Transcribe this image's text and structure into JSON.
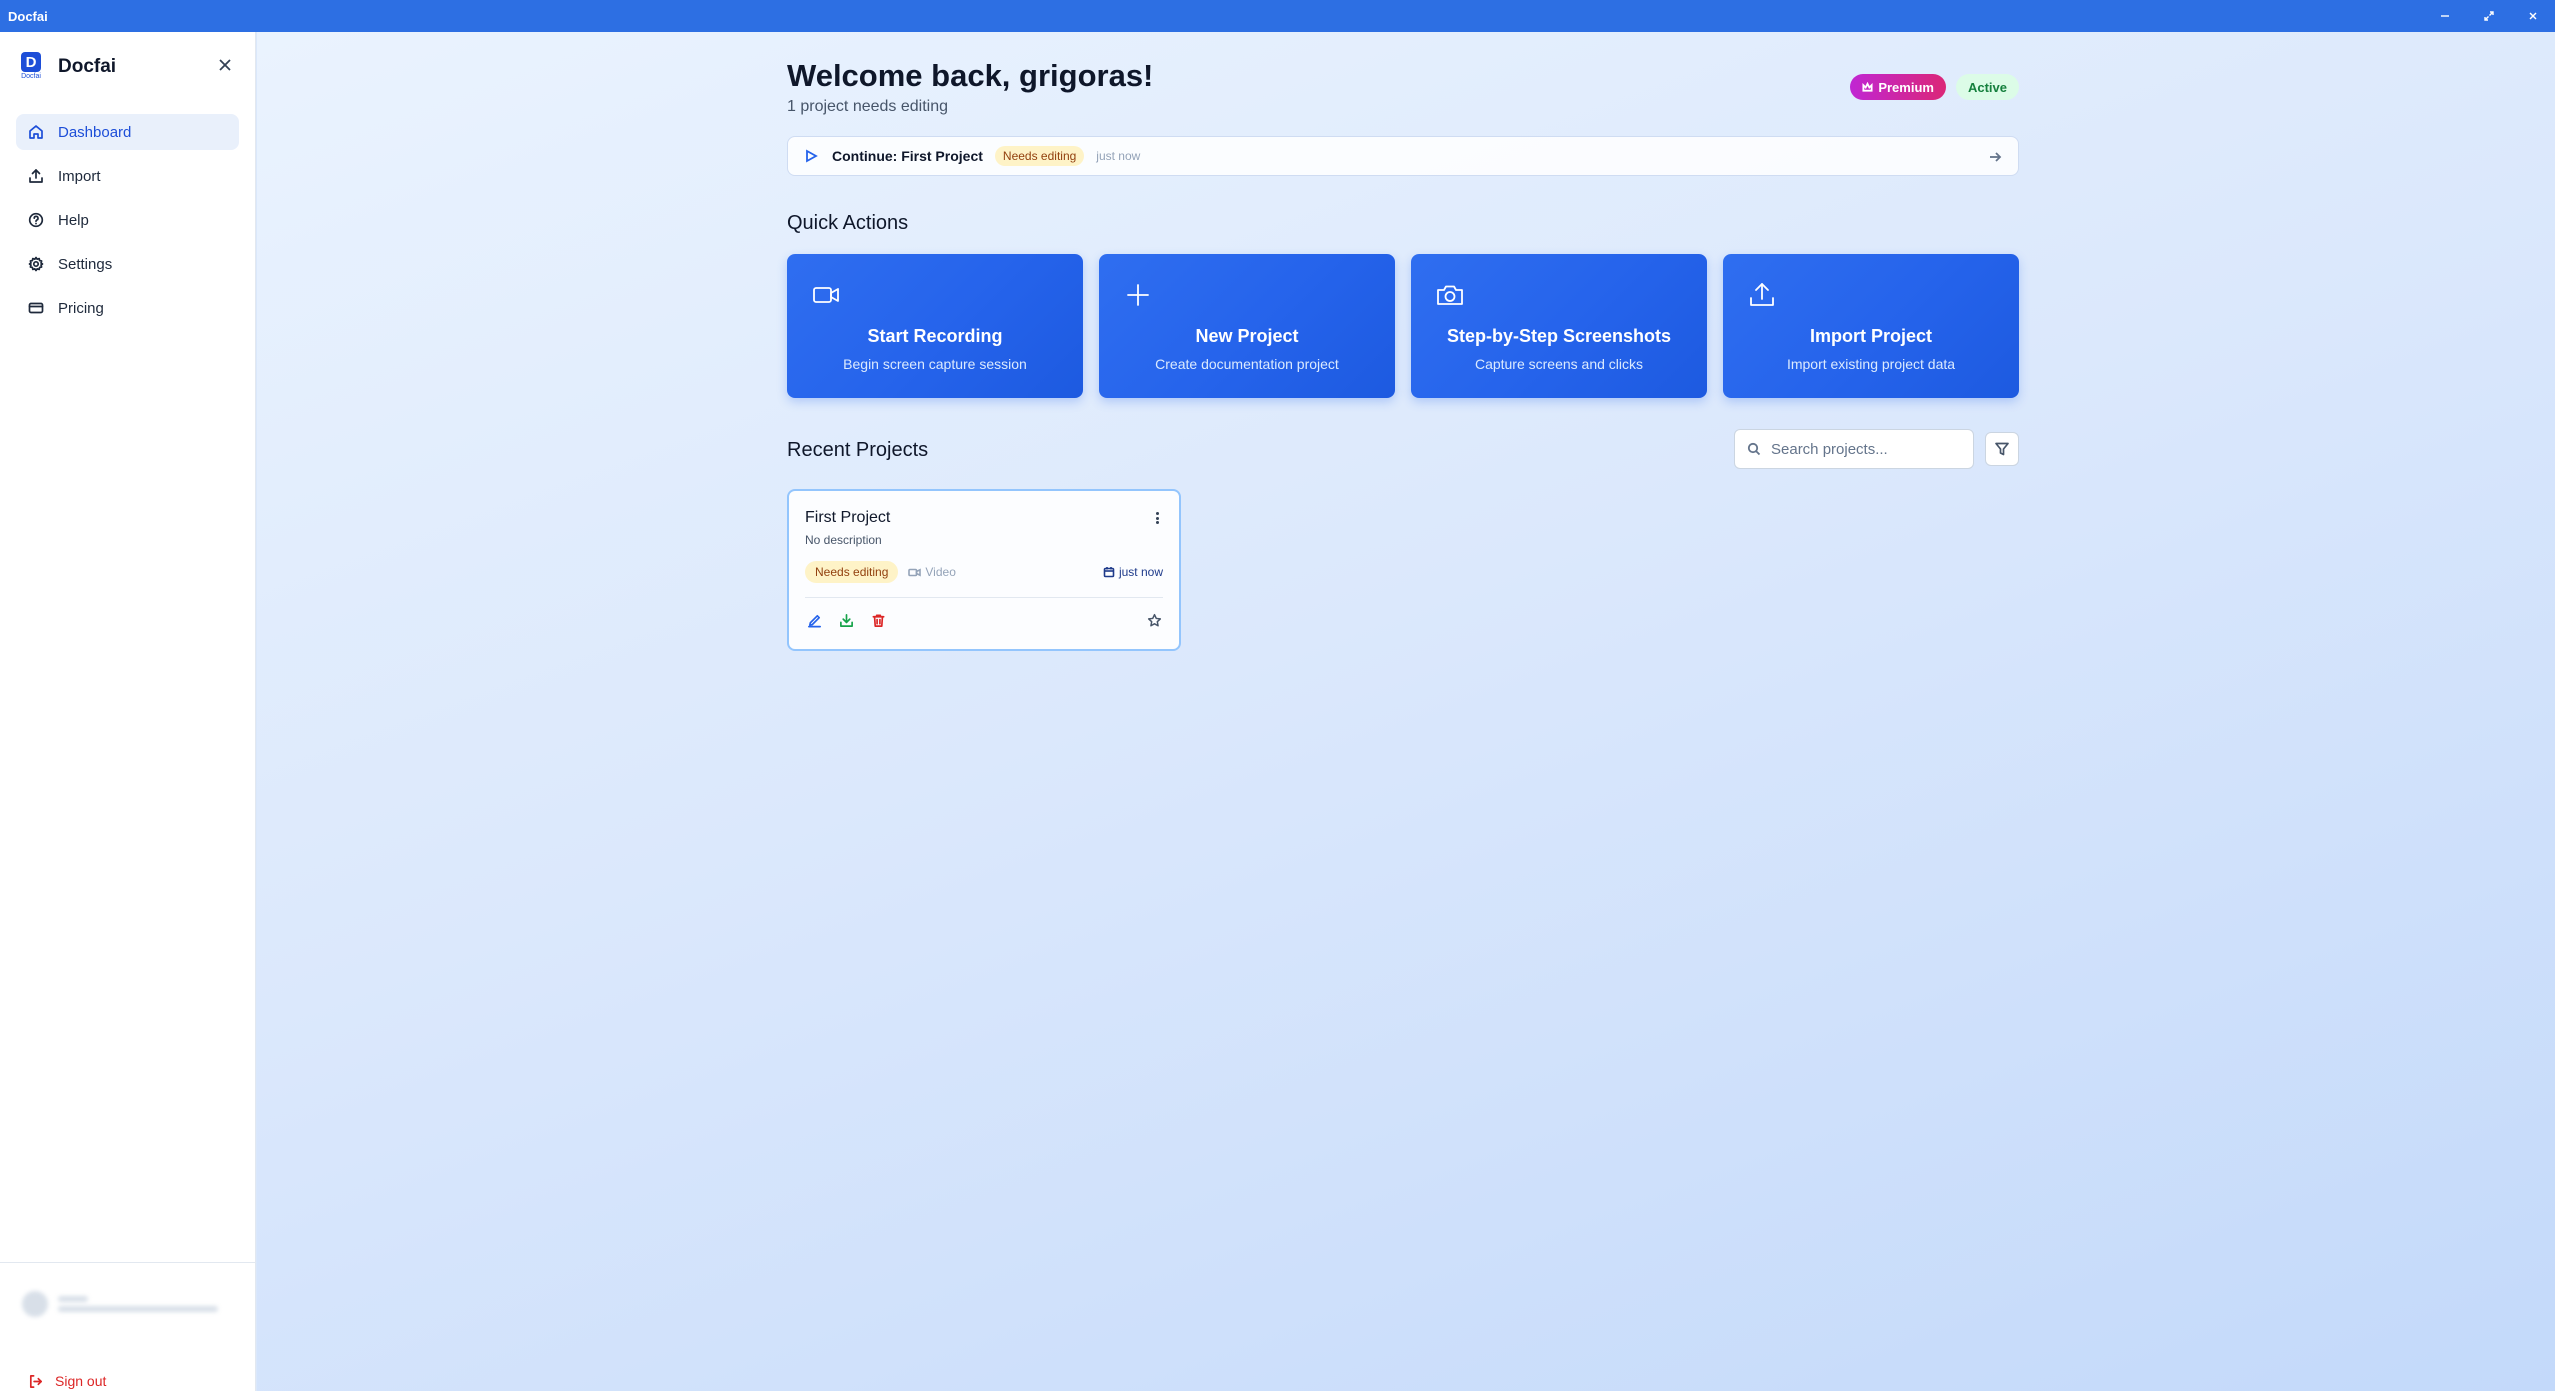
{
  "window": {
    "title": "Docfai",
    "controls": [
      "minimize-icon",
      "maximize-icon",
      "close-icon"
    ]
  },
  "sidebar": {
    "brand_name": "Docfai",
    "logo_letter": "D",
    "logo_sub": "Docfai",
    "items": [
      {
        "label": "Dashboard",
        "icon": "home-icon",
        "active": true
      },
      {
        "label": "Import",
        "icon": "upload-icon",
        "active": false
      },
      {
        "label": "Help",
        "icon": "help-circle-icon",
        "active": false
      },
      {
        "label": "Settings",
        "icon": "gear-icon",
        "active": false
      },
      {
        "label": "Pricing",
        "icon": "credit-card-icon",
        "active": false
      }
    ],
    "sign_out_label": "Sign out"
  },
  "header": {
    "welcome": "Welcome back, grigoras!",
    "subtitle": "1 project needs editing",
    "premium_label": "Premium",
    "active_label": "Active"
  },
  "continue": {
    "label": "Continue: First Project",
    "status": "Needs editing",
    "time": "just now"
  },
  "quick_actions": {
    "title": "Quick Actions",
    "cards": [
      {
        "title": "Start Recording",
        "subtitle": "Begin screen capture session",
        "icon": "video-camera-icon"
      },
      {
        "title": "New Project",
        "subtitle": "Create documentation project",
        "icon": "plus-icon"
      },
      {
        "title": "Step-by-Step Screenshots",
        "subtitle": "Capture screens and clicks",
        "icon": "camera-icon"
      },
      {
        "title": "Import Project",
        "subtitle": "Import existing project data",
        "icon": "upload-icon"
      }
    ]
  },
  "recent_projects": {
    "title": "Recent Projects",
    "search_placeholder": "Search projects...",
    "search_value": "",
    "projects": [
      {
        "name": "First Project",
        "description": "No description",
        "status": "Needs editing",
        "type": "Video",
        "date": "just now"
      }
    ]
  },
  "colors": {
    "accent": "#2563eb",
    "titlebar": "#2d6fe3",
    "premium": "#c026d3",
    "active": "#15803d",
    "needs_editing_bg": "#fef3c7",
    "sign_out": "#dc2626"
  }
}
